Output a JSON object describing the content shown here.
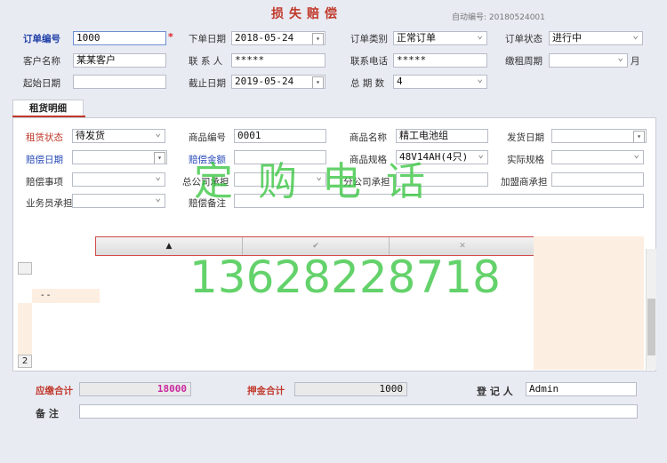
{
  "header": {
    "title": "损失赔偿",
    "auto_no": "自动编号: 20180524001"
  },
  "order": {
    "order_no_label": "订单编号",
    "order_no": "1000",
    "required_mark": "*",
    "order_date_label": "下单日期",
    "order_date": "2018-05-24",
    "order_type_label": "订单类别",
    "order_type": "正常订单",
    "order_status_label": "订单状态",
    "order_status": "进行中",
    "customer_label": "客户名称",
    "customer": "某某客户",
    "contact_label": "联 系 人",
    "contact": "*****",
    "phone_label": "联系电话",
    "phone": "*****",
    "rent_cycle_label": "缴租周期",
    "rent_cycle": "",
    "rent_cycle_unit": "月",
    "start_date_label": "起始日期",
    "start_date": "",
    "end_date_label": "截止日期",
    "end_date": "2019-05-24",
    "periods_label": "总 期 数",
    "periods": "4"
  },
  "tab": {
    "label": "租货明细"
  },
  "detail": {
    "rent_status_label": "租赁状态",
    "rent_status": "待发货",
    "product_code_label": "商品编号",
    "product_code": "0001",
    "product_name_label": "商品名称",
    "product_name": "精工电池组",
    "ship_date_label": "发货日期",
    "ship_date": "",
    "comp_date_label": "赔偿日期",
    "comp_date": "",
    "comp_amount_label": "赔偿金额",
    "comp_amount": "",
    "spec_label": "商品规格",
    "spec": "48V14AH(4只)",
    "actual_spec_label": "实际规格",
    "actual_spec": "",
    "comp_item_label": "赔偿事项",
    "comp_item": "",
    "hq_bear_label": "总公司承担",
    "hq_bear": "",
    "branch_bear_label": "分公司承担",
    "branch_bear": "",
    "franchise_bear_label": "加盟商承担",
    "franchise_bear": "",
    "sales_bear_label": "业务员承担",
    "sales_bear": "",
    "comp_note_label": "赔偿备注",
    "comp_note": ""
  },
  "toolbar": {
    "up": "▲",
    "ok": "✔",
    "cancel": "✕"
  },
  "grid": {
    "row_num": "2",
    "cell_text": "- -"
  },
  "watermark": {
    "line1": "定购电话",
    "line2": "13628228718"
  },
  "footer": {
    "due_total_label": "应缴合计",
    "due_total": "18000",
    "deposit_total_label": "押金合计",
    "deposit_total": "1000",
    "registrar_label": "登 记 人",
    "registrar": "Admin",
    "note_label": "备  注",
    "note": ""
  }
}
